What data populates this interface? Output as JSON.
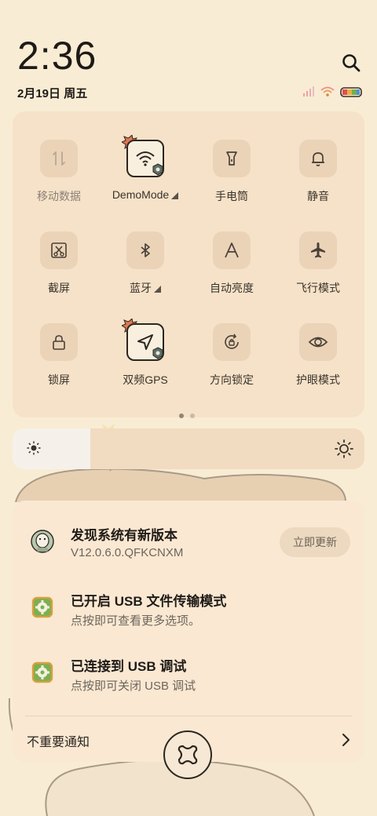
{
  "status": {
    "time": "2:36",
    "date": "2月19日 周五"
  },
  "quick_settings": {
    "tiles": [
      {
        "label": "移动数据",
        "icon": "mobile-data-icon",
        "active": false
      },
      {
        "label": "DemoMode",
        "icon": "wifi-icon",
        "active": true
      },
      {
        "label": "手电筒",
        "icon": "flashlight-icon",
        "active": false
      },
      {
        "label": "静音",
        "icon": "bell-icon",
        "active": false
      },
      {
        "label": "截屏",
        "icon": "screenshot-icon",
        "active": false
      },
      {
        "label": "蓝牙",
        "icon": "bluetooth-icon",
        "active": false
      },
      {
        "label": "自动亮度",
        "icon": "auto-brightness-icon",
        "active": false
      },
      {
        "label": "飞行模式",
        "icon": "airplane-icon",
        "active": false
      },
      {
        "label": "锁屏",
        "icon": "lock-icon",
        "active": false
      },
      {
        "label": "双频GPS",
        "icon": "gps-icon",
        "active": true
      },
      {
        "label": "方向锁定",
        "icon": "rotation-lock-icon",
        "active": false
      },
      {
        "label": "护眼模式",
        "icon": "eye-icon",
        "active": false
      }
    ],
    "page_index": 1,
    "page_count": 2
  },
  "brightness": {
    "level": 0.22
  },
  "notifications": {
    "items": [
      {
        "title": "发现系统有新版本",
        "text": "V12.0.6.0.QFKCNXM",
        "action": "立即更新",
        "icon": "update-robot-icon"
      },
      {
        "title": "已开启 USB 文件传输模式",
        "text": "点按即可查看更多选项。",
        "icon": "settings-gear-icon"
      },
      {
        "title": "已连接到 USB 调试",
        "text": "点按即可关闭 USB 调试",
        "icon": "settings-gear-icon"
      }
    ],
    "unimportant_label": "不重要通知"
  },
  "colors": {
    "background": "#f8ecd4",
    "panel": "#f6e2c8",
    "tile": "#ead3b7"
  }
}
